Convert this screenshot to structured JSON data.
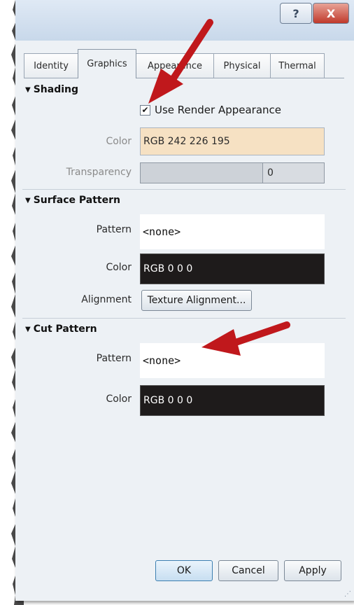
{
  "titlebar": {
    "help_label": "?",
    "close_label": "X"
  },
  "tabs": [
    {
      "label": "Identity",
      "active": false
    },
    {
      "label": "Graphics",
      "active": true
    },
    {
      "label": "Appearance",
      "active": false
    },
    {
      "label": "Physical",
      "active": false
    },
    {
      "label": "Thermal",
      "active": false
    }
  ],
  "shading": {
    "header": "Shading",
    "use_render_label": "Use Render Appearance",
    "use_render_checked": true,
    "color_label": "Color",
    "color_value": "RGB 242 226 195",
    "transparency_label": "Transparency",
    "transparency_value": "0"
  },
  "surface_pattern": {
    "header": "Surface Pattern",
    "pattern_label": "Pattern",
    "pattern_value": "<none>",
    "color_label": "Color",
    "color_value": "RGB 0 0 0",
    "alignment_label": "Alignment",
    "alignment_button": "Texture Alignment..."
  },
  "cut_pattern": {
    "header": "Cut Pattern",
    "pattern_label": "Pattern",
    "pattern_value": "<none>",
    "color_label": "Color",
    "color_value": "RGB 0 0 0"
  },
  "footer": {
    "ok_label": "OK",
    "cancel_label": "Cancel",
    "apply_label": "Apply"
  },
  "colors": {
    "annotation_arrow": "#c0181c",
    "shading_color": "#f2e2c3",
    "black_swatch": "#000000"
  }
}
